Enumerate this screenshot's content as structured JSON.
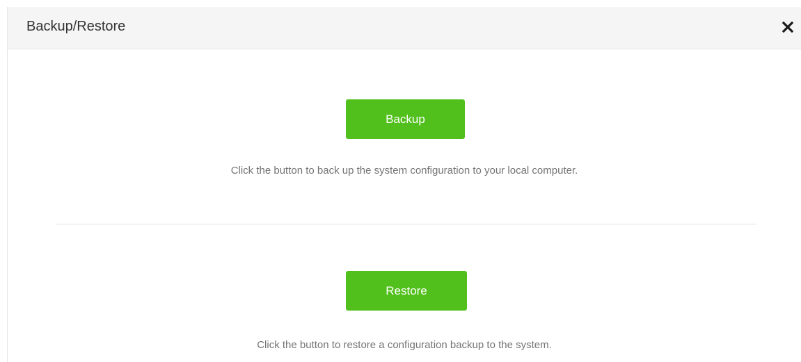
{
  "dialog": {
    "title": "Backup/Restore",
    "close_icon": "close-icon"
  },
  "backup": {
    "button_label": "Backup",
    "description": "Click the button to back up the system configuration to your local computer."
  },
  "restore": {
    "button_label": "Restore",
    "description": "Click the button to restore a configuration backup to the system."
  },
  "colors": {
    "accent": "#52c01c",
    "header_bg": "#f5f5f5",
    "title_text": "#333333",
    "description_text": "#747474",
    "divider": "#e2e2e2"
  }
}
